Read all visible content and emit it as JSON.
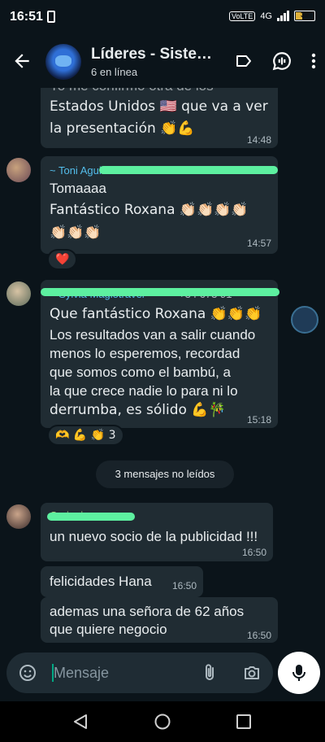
{
  "status_bar": {
    "time": "16:51",
    "network": "VoLTE",
    "signal": "4G",
    "battery": "39"
  },
  "header": {
    "title": "Líderes - Siste…",
    "subtitle": "6 en línea"
  },
  "messages": [
    {
      "lines": [
        "Yo me confirmó otra de los",
        "Estados Unidos 🇺🇸 que va a ver",
        "la presentación 👏💪"
      ],
      "time": "14:48"
    },
    {
      "author": "~ Toni Aguilar Saez",
      "lines": [
        "Tomaaaa",
        "Fantástico Roxana 👏🏻👏🏻👏🏻👏🏻",
        "👏🏻👏🏻👏🏻"
      ],
      "time": "14:57",
      "reaction": "❤️"
    },
    {
      "author": "~ Sylvia Magiotravel",
      "phone": "+34 673 91",
      "lines": [
        "Que fantástico Roxana 👏👏👏",
        "Los resultados van a salir cuando",
        "menos lo esperemos, recordad",
        "que somos como el bambú, a",
        "la que crece nadie lo para ni lo",
        "derrumba, es sólido 💪🎋"
      ],
      "time": "15:18",
      "reaction": "🫶 💪 👏 3"
    },
    {
      "author": "Corinaiosem",
      "lines": [
        "un nuevo socio de la publicidad !!!"
      ],
      "time": "16:50"
    },
    {
      "lines": [
        "felicidades Hana"
      ],
      "time": "16:50"
    },
    {
      "lines": [
        "ademas una señora de 62 años",
        "que quiere negocio"
      ],
      "time": "16:50"
    }
  ],
  "unread_label": "3 mensajes no leídos",
  "composer": {
    "placeholder": "Mensaje"
  },
  "colors": {
    "background": "#0b141a",
    "bubble": "#202c33",
    "accent": "#00a884",
    "highlight": "#5df0a0"
  }
}
